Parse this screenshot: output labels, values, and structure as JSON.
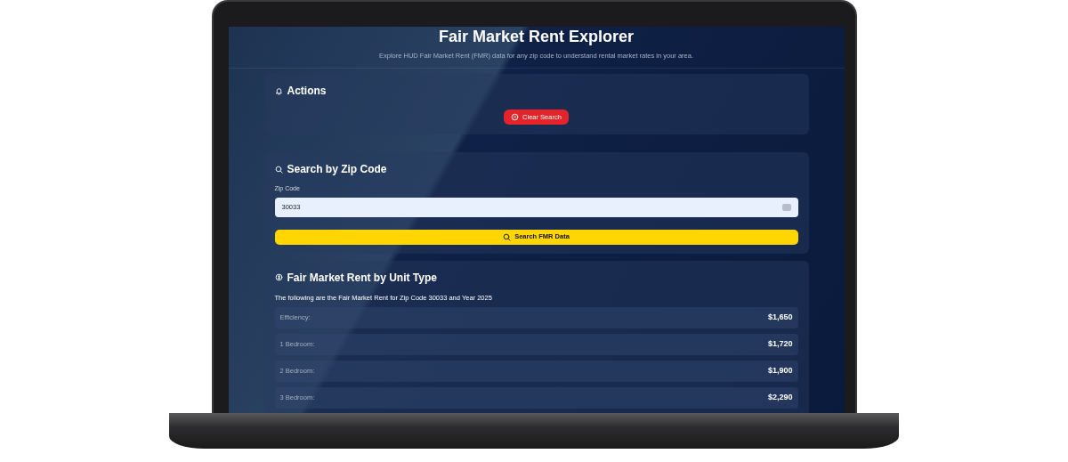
{
  "header": {
    "title": "Fair Market Rent Explorer",
    "subtitle": "Explore HUD Fair Market Rent (FMR) data for any zip code to understand rental market rates in your area."
  },
  "actions": {
    "title": "Actions",
    "button": "Clear Search"
  },
  "search": {
    "title": "Search by Zip Code",
    "label": "Zip Code",
    "value": "30033",
    "button": "Search FMR Data"
  },
  "rents": {
    "title": "Fair Market Rent by Unit Type",
    "intro": "The following are the Fair Market Rent for Zip Code 30033 and Year 2025",
    "rows": [
      {
        "label": "Efficiency:",
        "value": "$1,650"
      },
      {
        "label": "1 Bedroom:",
        "value": "$1,720"
      },
      {
        "label": "2 Bedroom:",
        "value": "$1,900"
      },
      {
        "label": "3 Bedroom:",
        "value": "$2,290"
      }
    ]
  }
}
